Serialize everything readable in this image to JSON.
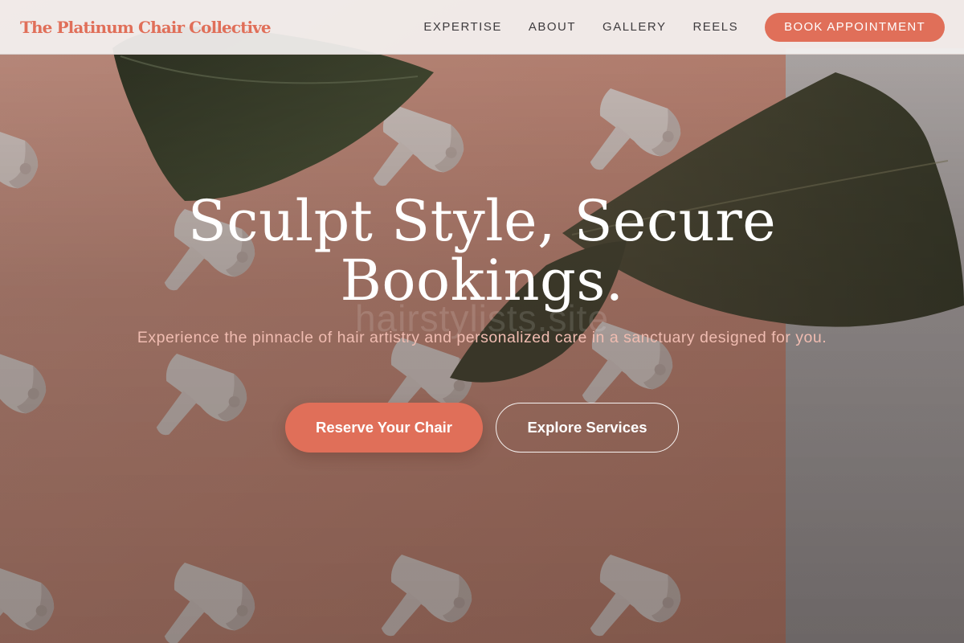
{
  "nav": {
    "brand": "The Platinum Chair Collective",
    "links": [
      {
        "label": "EXPERTISE"
      },
      {
        "label": "ABOUT"
      },
      {
        "label": "GALLERY"
      },
      {
        "label": "REELS"
      }
    ],
    "cta_label": "BOOK APPOINTMENT"
  },
  "hero": {
    "title_line1": "Sculpt Style, Secure",
    "title_line2": "Bookings.",
    "watermark": "hairstylists.site",
    "subtitle": "Experience the pinnacle of hair artistry and personalized care in a sanctuary designed for you.",
    "primary_button": "Reserve Your Chair",
    "secondary_button": "Explore Services"
  },
  "colors": {
    "accent": "#e06f59",
    "nav_background": "#f4f1f0",
    "nav_text": "#3e3b3e",
    "subtitle_text": "#f0bcb1",
    "hero_background": "#d99a88"
  },
  "background_image": {
    "subjects": [
      "hair-dryer",
      "tropical-leaf"
    ]
  }
}
